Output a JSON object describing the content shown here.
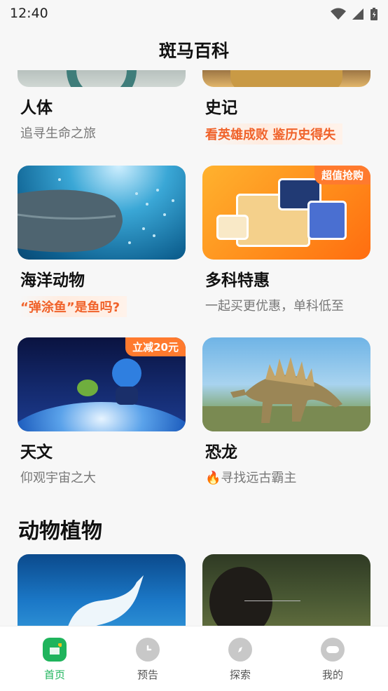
{
  "status": {
    "time": "12:40"
  },
  "header": {
    "title": "斑马百科"
  },
  "cards": [
    {
      "title": "人体",
      "subtitle": "追寻生命之旅"
    },
    {
      "title": "史记",
      "subtitle": "看英雄成败 鉴历史得失"
    },
    {
      "title": "海洋动物",
      "subtitle": "“弹涂鱼”是鱼吗?"
    },
    {
      "title": "多科特惠",
      "subtitle": "一起买更优惠，单科低至",
      "badge": "超值抢购"
    },
    {
      "title": "天文",
      "subtitle": "仰观宇宙之大",
      "badge": "立减20元"
    },
    {
      "title": "恐龙",
      "subtitle": "寻找远古霸主"
    }
  ],
  "section": {
    "title": "动物植物"
  },
  "tabs": [
    {
      "label": "首页"
    },
    {
      "label": "预告"
    },
    {
      "label": "探索"
    },
    {
      "label": "我的"
    }
  ],
  "colors": {
    "accent": "#1fb45c",
    "highlight": "#f0622a",
    "badge": "#ff7a2e"
  }
}
